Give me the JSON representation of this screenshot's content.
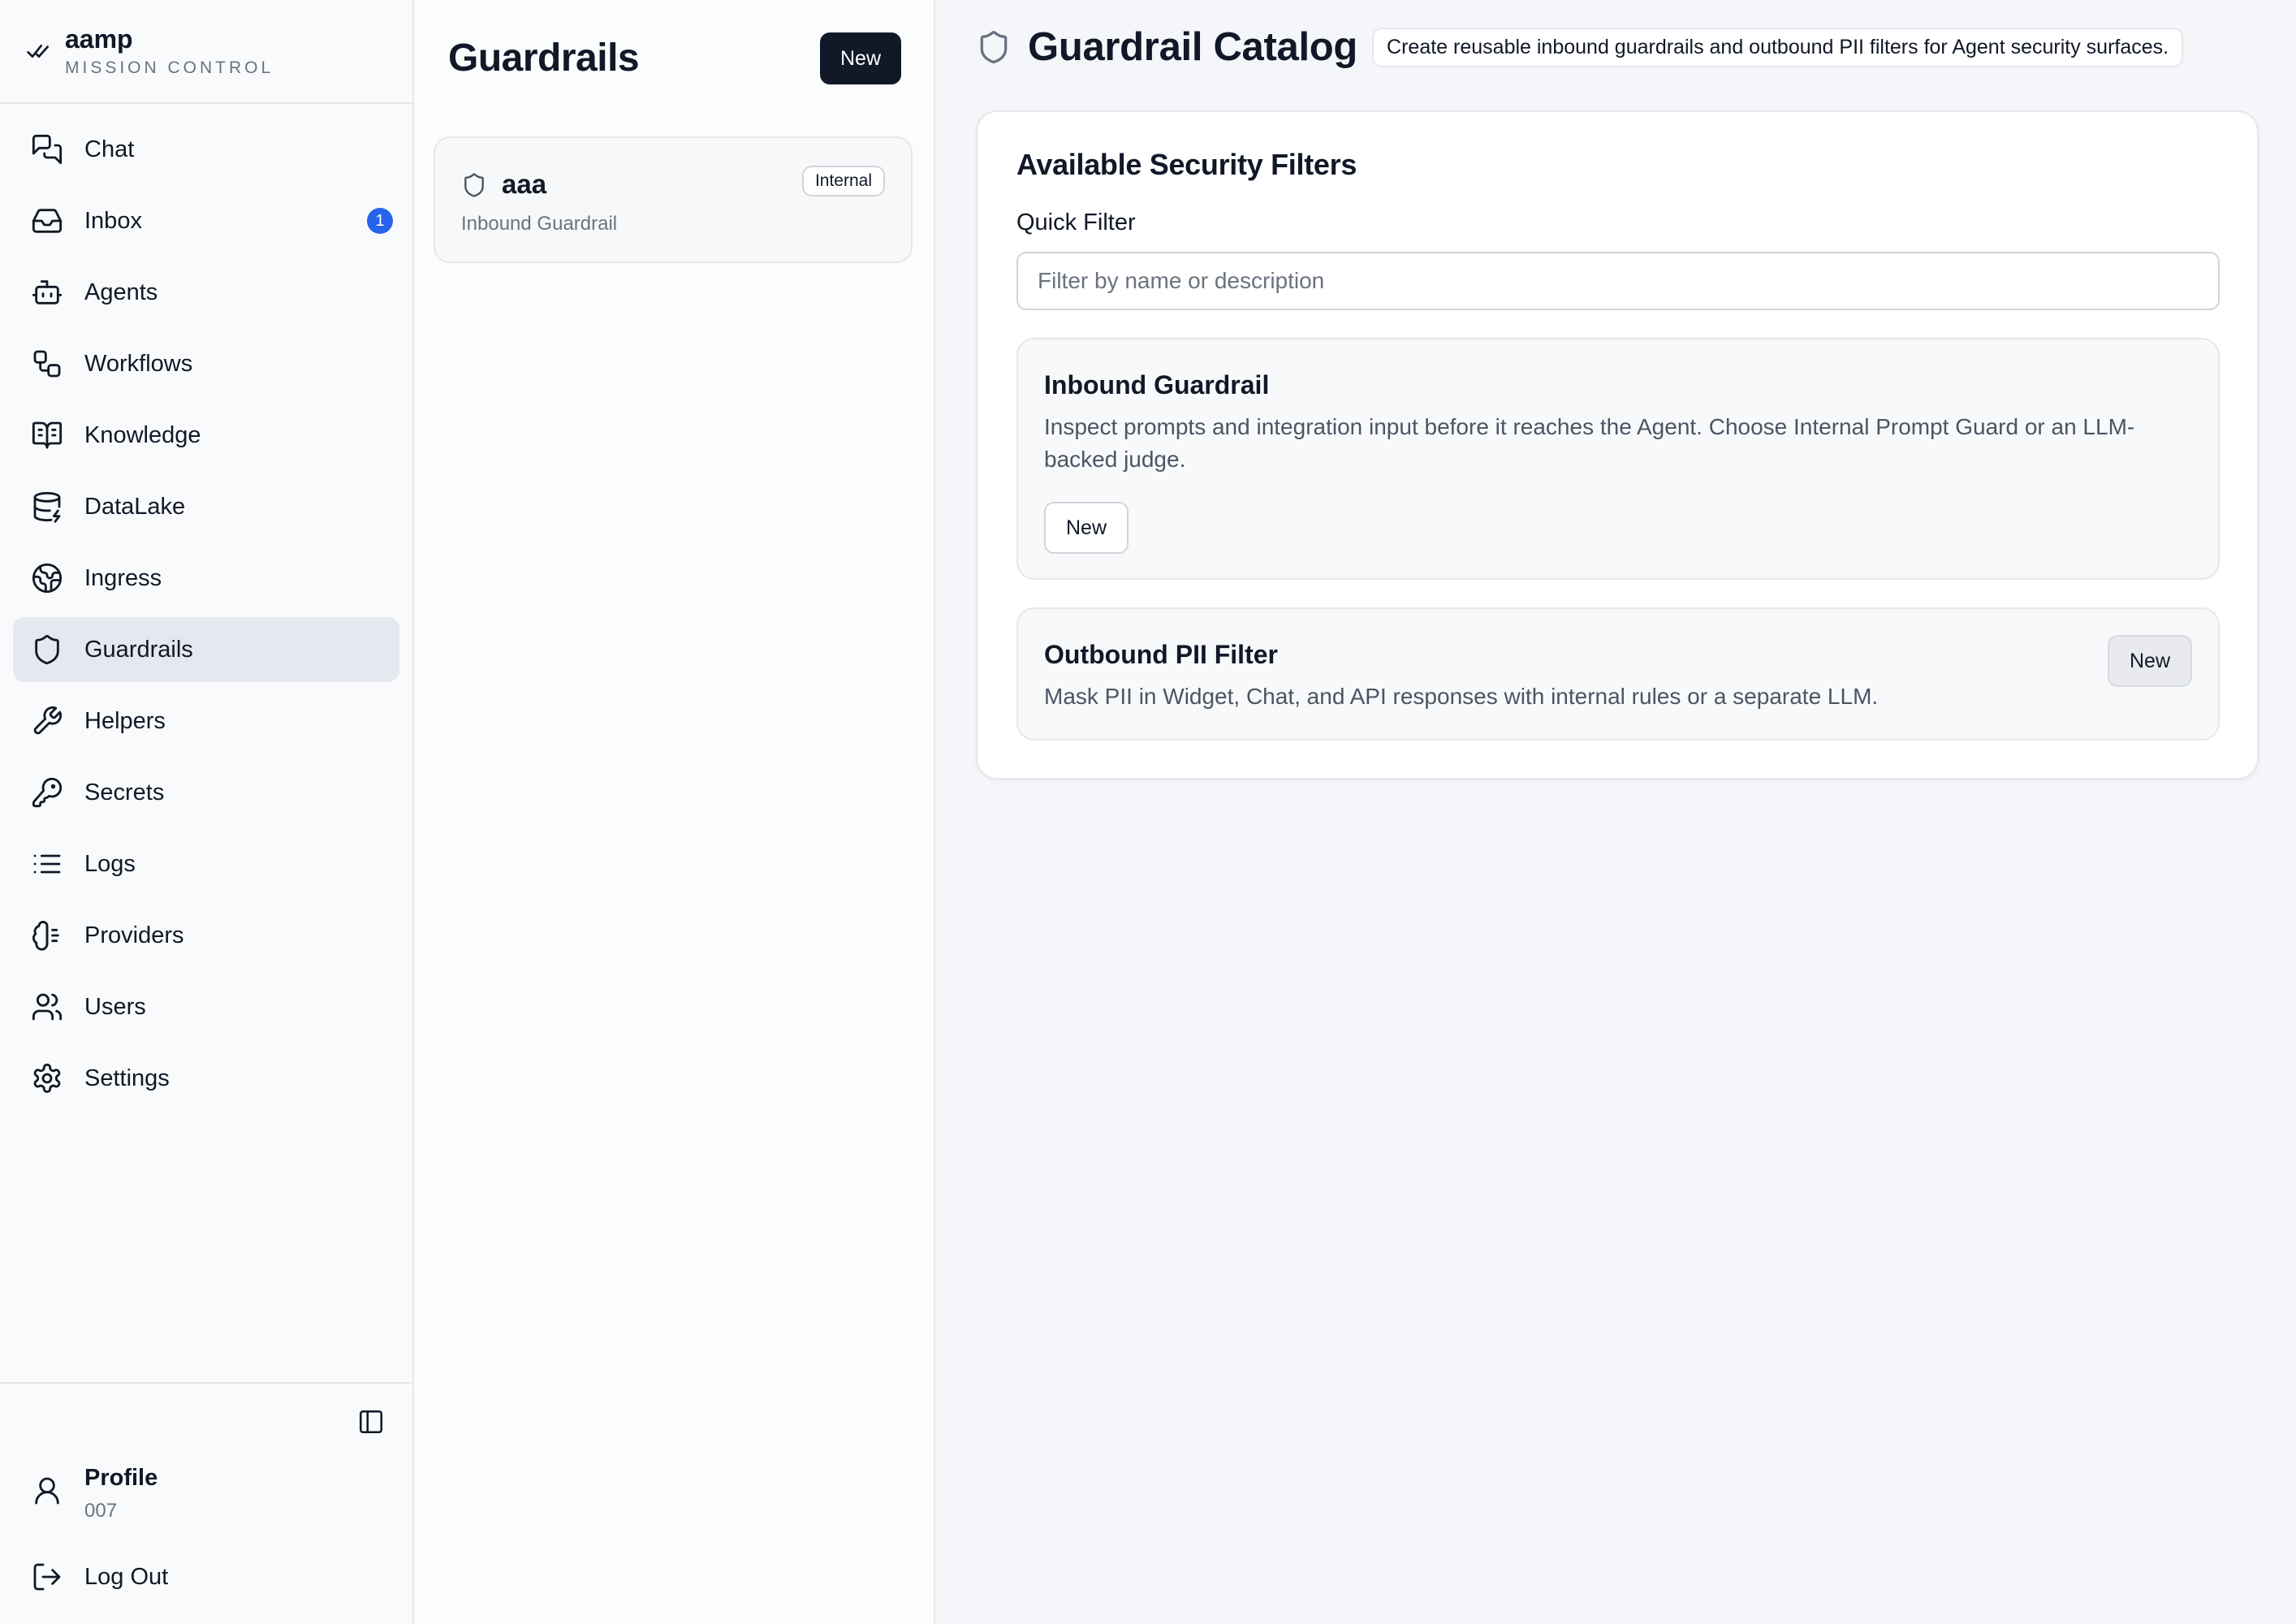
{
  "brand": {
    "name": "aamp",
    "subtitle": "MISSION CONTROL"
  },
  "sidebar": {
    "items": [
      {
        "label": "Chat",
        "icon": "chat-icon"
      },
      {
        "label": "Inbox",
        "icon": "inbox-icon",
        "badge": "1"
      },
      {
        "label": "Agents",
        "icon": "robot-icon"
      },
      {
        "label": "Workflows",
        "icon": "workflow-icon"
      },
      {
        "label": "Knowledge",
        "icon": "book-icon"
      },
      {
        "label": "DataLake",
        "icon": "database-icon"
      },
      {
        "label": "Ingress",
        "icon": "globe-icon"
      },
      {
        "label": "Guardrails",
        "icon": "shield-icon",
        "active": true
      },
      {
        "label": "Helpers",
        "icon": "wrench-icon"
      },
      {
        "label": "Secrets",
        "icon": "key-icon"
      },
      {
        "label": "Logs",
        "icon": "list-icon"
      },
      {
        "label": "Providers",
        "icon": "brain-icon"
      },
      {
        "label": "Users",
        "icon": "users-icon"
      },
      {
        "label": "Settings",
        "icon": "gear-icon"
      }
    ],
    "profile": {
      "name": "Profile",
      "id": "007"
    },
    "logout_label": "Log Out"
  },
  "list": {
    "title": "Guardrails",
    "new_label": "New",
    "items": [
      {
        "name": "aaa",
        "type": "Inbound Guardrail",
        "tag": "Internal"
      }
    ]
  },
  "main": {
    "title": "Guardrail Catalog",
    "description": "Create reusable inbound guardrails and outbound PII filters for Agent security surfaces.",
    "panel_title": "Available Security Filters",
    "filter_label": "Quick Filter",
    "filter_placeholder": "Filter by name or description",
    "filter_value": "",
    "catalog": [
      {
        "title": "Inbound Guardrail",
        "description": "Inspect prompts and integration input before it reaches the Agent. Choose Internal Prompt Guard or an LLM-backed judge.",
        "button": "New"
      },
      {
        "title": "Outbound PII Filter",
        "description": "Mask PII in Widget, Chat, and API responses with internal rules or a separate LLM.",
        "button": "New"
      }
    ]
  },
  "colors": {
    "accent_dark": "#111827",
    "badge_blue": "#2563eb",
    "active_bg": "#e5e8ee"
  }
}
